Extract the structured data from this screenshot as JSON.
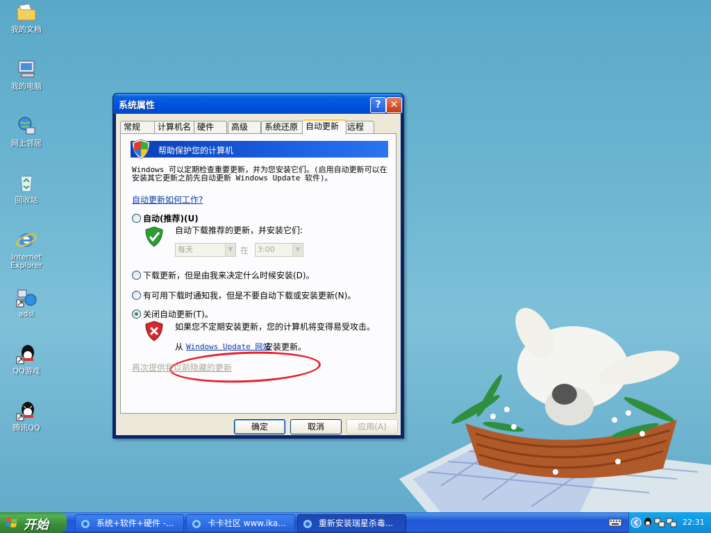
{
  "desktop": {
    "icons": [
      {
        "label": "我的文档",
        "icon": "folder-icon"
      },
      {
        "label": "我的电脑",
        "icon": "computer-icon"
      },
      {
        "label": "网上邻居",
        "icon": "network-icon"
      },
      {
        "label": "回收站",
        "icon": "recycle-bin-icon"
      },
      {
        "label": "Internet Explorer",
        "icon": "ie-icon"
      },
      {
        "label": "adsl",
        "icon": "connection-icon"
      },
      {
        "label": "QQ游戏",
        "icon": "qq-game-icon"
      },
      {
        "label": "腾讯QQ",
        "icon": "qq-icon"
      }
    ]
  },
  "dialog": {
    "title": "系统属性",
    "help": "?",
    "close": "✕",
    "tabs": [
      "常规",
      "计算机名",
      "硬件",
      "高级",
      "系统还原",
      "自动更新",
      "远程"
    ],
    "active_tab": "自动更新",
    "banner": "帮助保护您的计算机",
    "description": "Windows 可以定期检查重要更新，并为您安装它们。(启用自动更新可以在安装其它更新之前先自动更新 Windows Update 软件)。",
    "how_link": "自动更新如何工作?",
    "options": {
      "auto": {
        "label": "自动(推荐)(U)",
        "sub": "自动下载推荐的更新，并安装它们:",
        "day": "每天",
        "at": "在",
        "time": "3:00"
      },
      "download": {
        "label": "下载更新，但是由我来决定什么时候安装(D)。"
      },
      "notify": {
        "label": "有可用下载时通知我，但是不要自动下载或安装更新(N)。"
      },
      "off": {
        "label": "关闭自动更新(T)。",
        "warning": "如果您不定期安装更新，您的计算机将变得易受攻击。",
        "from": "从",
        "wu_link": "Windows Update 网站",
        "install": "安装更新。"
      }
    },
    "selected_option": "off",
    "hidden_link": "再次提供我以前隐藏的更新",
    "buttons": {
      "ok": "确定",
      "cancel": "取消",
      "apply": "应用(A)"
    }
  },
  "taskbar": {
    "start": "开始",
    "tasks": [
      {
        "label": "系统+软件+硬件 -..."
      },
      {
        "label": "卡卡社区 www.ika..."
      },
      {
        "label": "重新安装瑞星杀毒..."
      }
    ],
    "clock": "22:31"
  },
  "colors": {
    "accent": "#0054e3",
    "annotation": "#e8202a"
  }
}
